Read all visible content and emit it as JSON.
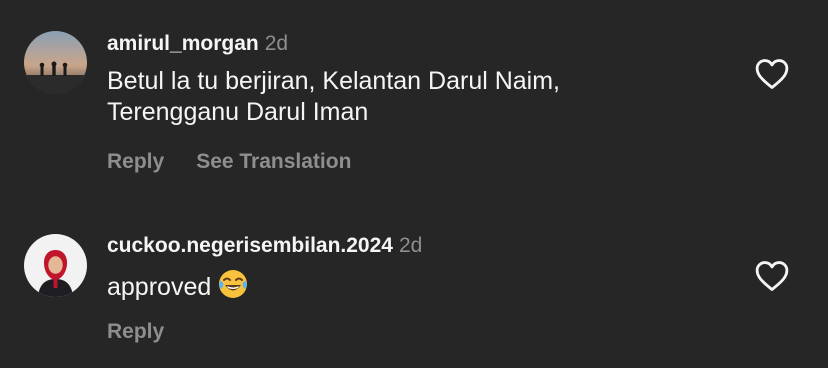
{
  "comments": [
    {
      "username": "amirul_morgan",
      "time": "2d",
      "text_lines": [
        "Betul la tu berjiran, Kelantan Darul Naim,",
        "Terengganu Darul Iman"
      ],
      "actions": [
        "Reply",
        "See Translation"
      ],
      "avatar_icon": "sunset-silhouette-avatar",
      "like_icon": "heart-outline-icon"
    },
    {
      "username": "cuckoo.negerisembilan.2024",
      "time": "2d",
      "text": "approved",
      "emoji": "😂",
      "emoji_icon": "face-with-tears-of-joy-icon",
      "actions": [
        "Reply"
      ],
      "avatar_icon": "woman-red-hijab-avatar",
      "like_icon": "heart-outline-icon"
    }
  ],
  "colors": {
    "background": "#262626",
    "primary_text": "#f5f5f5",
    "secondary_text": "#8e8e8e"
  }
}
